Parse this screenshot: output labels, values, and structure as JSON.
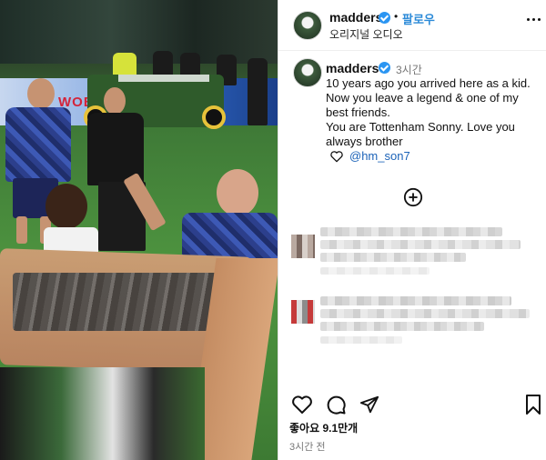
{
  "post": {
    "username": "madders",
    "follow_label": "팔로우",
    "audio_label": "오리지널 오디오",
    "caption_time": "3시간",
    "caption_lines": [
      "10 years ago you arrived here as a kid.",
      "Now you leave a legend & one of my",
      "best friends.",
      "You are Tottenham Sonny. Love you",
      "always brother"
    ],
    "mention": "@hm_son7",
    "likes": "좋아요 9.1만개",
    "posted_ago": "3시간 전"
  },
  "media": {
    "banner_text": "WOB"
  },
  "icons": {
    "more": "more-horizontal-icon",
    "verified": "verified-badge-icon",
    "heart_small": "heart-outline-icon",
    "plus": "plus-circle-icon",
    "like": "heart-icon",
    "comment": "comment-icon",
    "share": "send-icon",
    "save": "bookmark-icon"
  },
  "colors": {
    "follow": "#2b8ad8",
    "verified": "#2b95f2",
    "mention": "#1c63b8"
  }
}
